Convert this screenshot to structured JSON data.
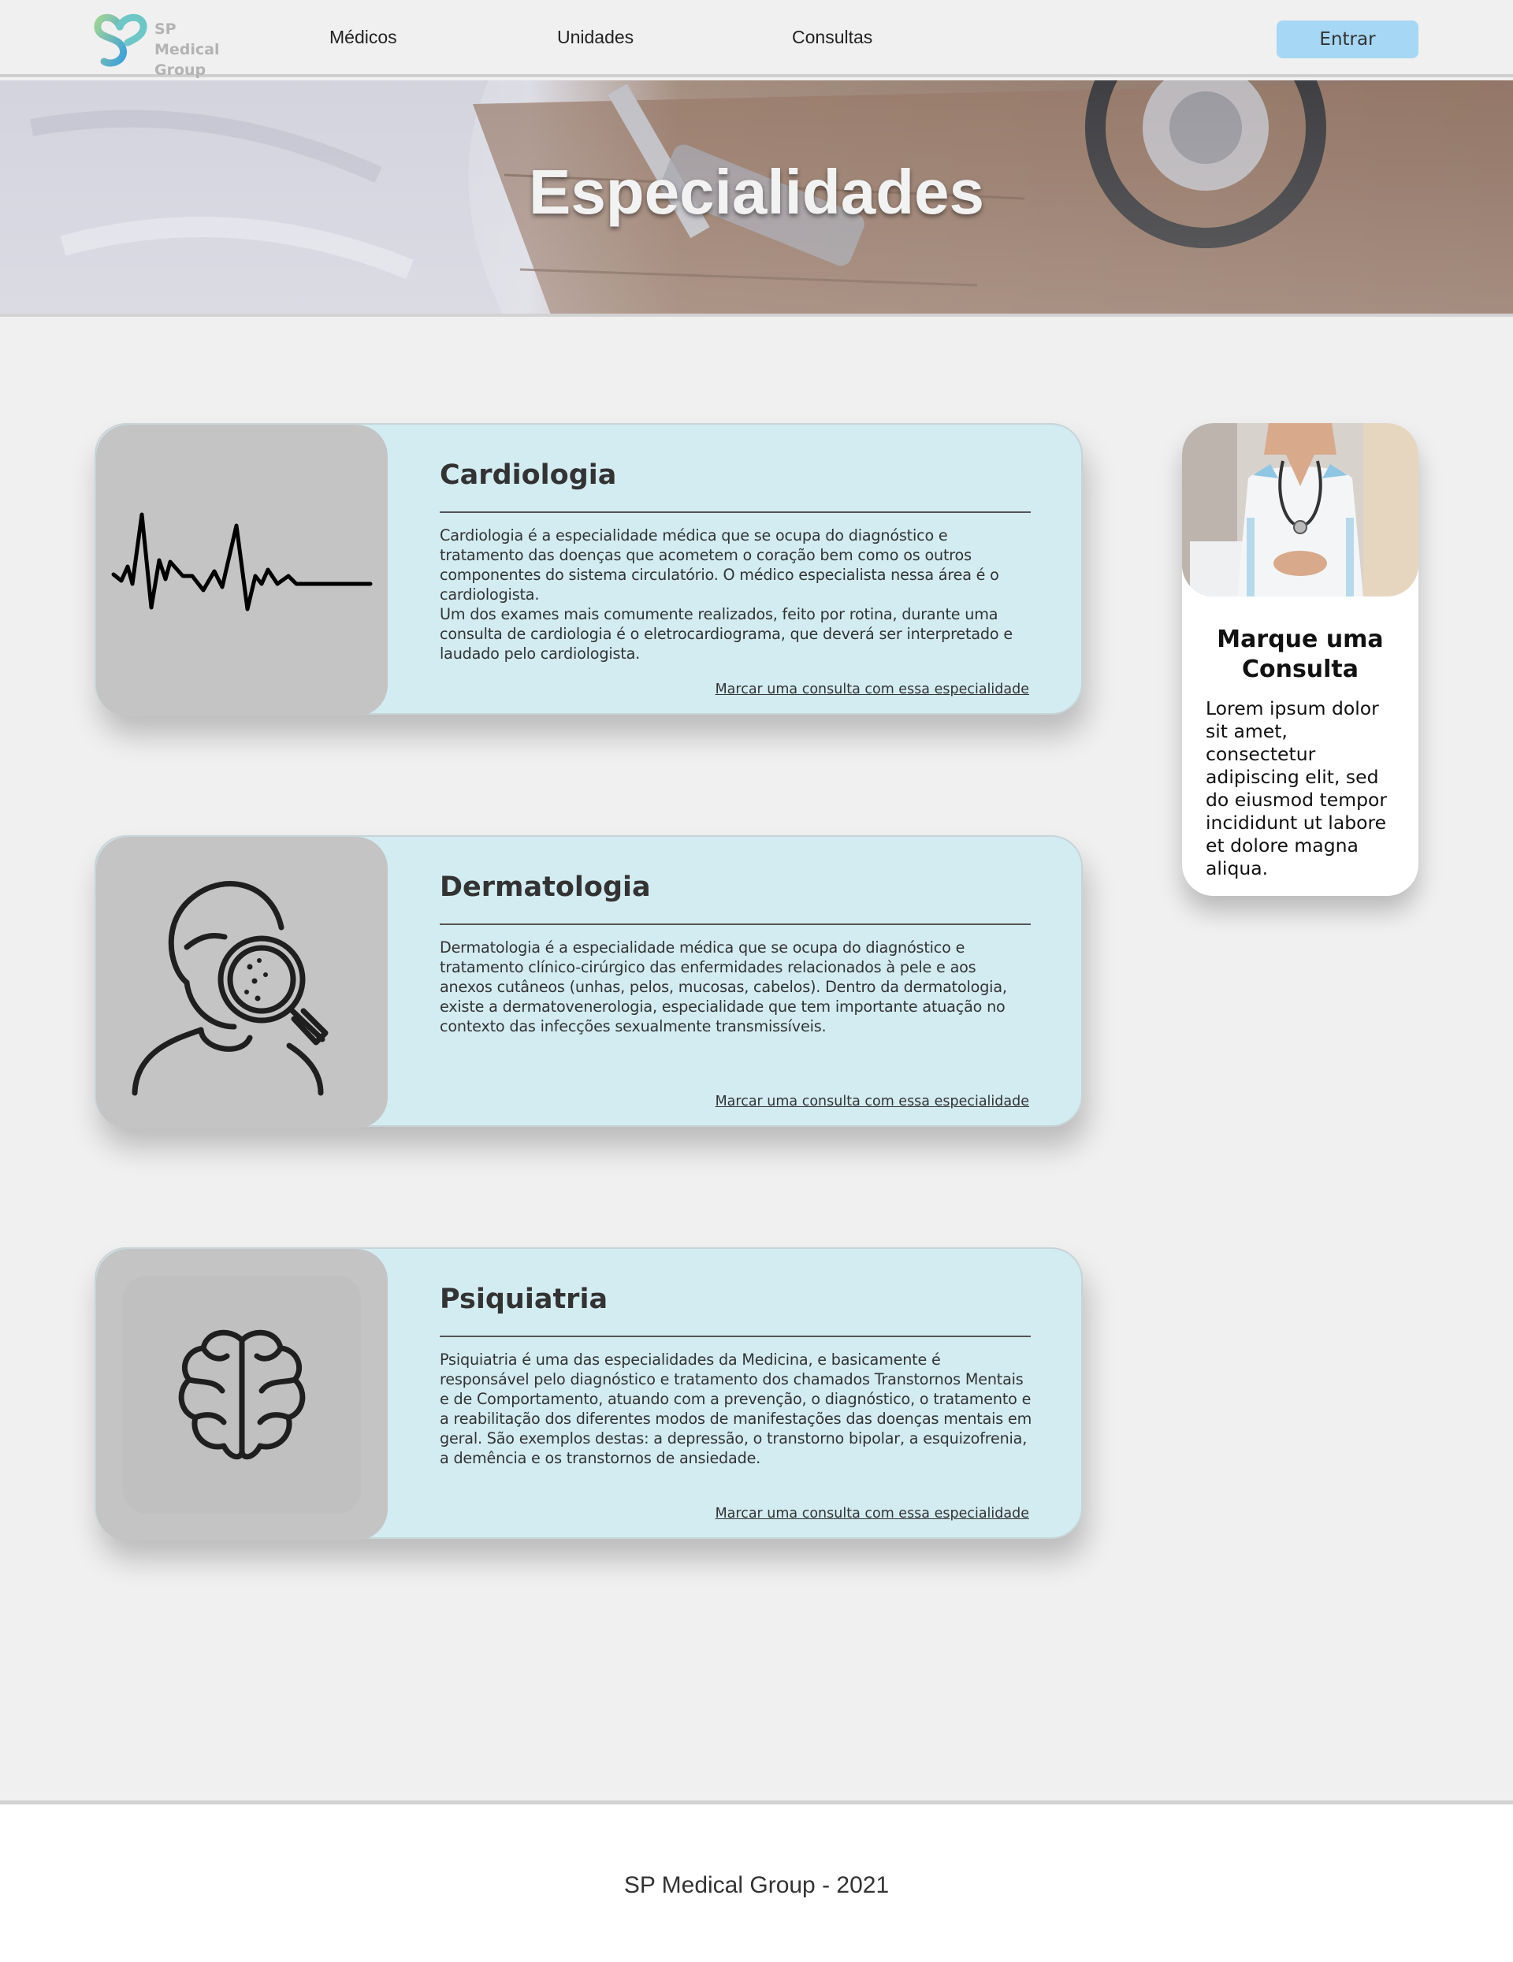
{
  "header": {
    "logo_text": "SP Medical Group",
    "nav": [
      "Médicos",
      "Unidades",
      "Consultas"
    ],
    "login_label": "Entrar"
  },
  "hero": {
    "title": "Especialidades"
  },
  "specialties": [
    {
      "name": "Cardiologia",
      "icon": "heartbeat-icon",
      "description": "Cardiologia é a especialidade médica que se ocupa do diagnóstico e tratamento das doenças que acometem o coração bem como os outros componentes do sistema circulatório. O médico especialista nessa área é o cardiologista.\nUm dos exames mais comumente realizados, feito por rotina, durante uma consulta de cardiologia é o eletrocardiograma, que deverá ser interpretado e laudado pelo cardiologista.",
      "link": "Marcar uma consulta com essa especialidade"
    },
    {
      "name": "Dermatologia",
      "icon": "skin-examination-icon",
      "description": "Dermatologia é a especialidade médica que se ocupa do diagnóstico e tratamento clínico-cirúrgico das enfermidades relacionados à pele e aos anexos cutâneos (unhas, pelos, mucosas, cabelos). Dentro da dermatologia, existe a dermatovenerologia, especialidade que tem importante atuação no contexto das infecções sexualmente transmissíveis.",
      "link": "Marcar uma consulta com essa especialidade"
    },
    {
      "name": "Psiquiatria",
      "icon": "brain-icon",
      "description": "Psiquiatria é uma das especialidades da Medicina, e basicamente é responsável pelo diagnóstico e tratamento dos chamados Transtornos Mentais e de Comportamento, atuando com a prevenção, o diagnóstico, o tratamento e a reabilitação dos diferentes modos de manifestações das doenças mentais em geral. São exemplos destas: a depressão, o transtorno bipolar, a esquizofrenia, a demência e os transtornos de ansiedade.",
      "link": "Marcar uma consulta com essa especialidade"
    }
  ],
  "side_card": {
    "title": "Marque uma Consulta",
    "text": "Lorem ipsum dolor sit amet, consectetur adipiscing elit, sed do eiusmod tempor incididunt ut labore et dolore magna aliqua."
  },
  "footer": {
    "text": "SP Medical Group - 2021"
  },
  "colors": {
    "page_bg": "#f0f0f0",
    "card_bg": "#d3ecf1",
    "icon_box_bg": "#c4c4c4",
    "button_bg": "#a6d7f5",
    "logo_green": "#8cc9a0",
    "logo_blue": "#4aa3d8"
  }
}
